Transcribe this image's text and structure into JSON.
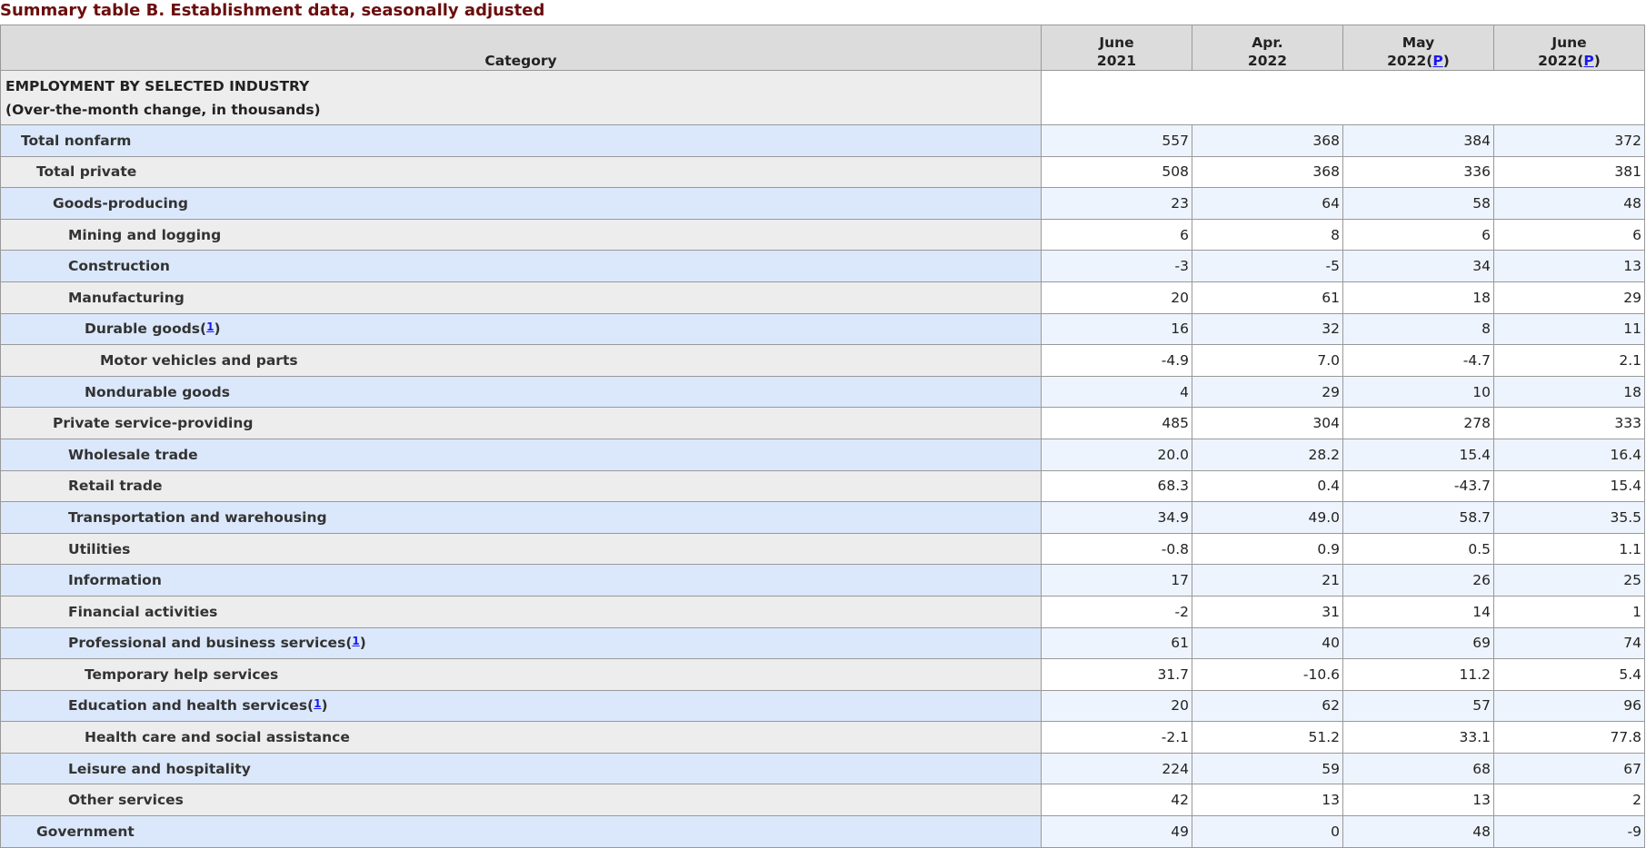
{
  "caption": "Summary table B. Establishment data, seasonally adjusted",
  "header": {
    "category": "Category",
    "columns": [
      {
        "line1": "June",
        "line2": "2021",
        "preliminary": false
      },
      {
        "line1": "Apr.",
        "line2": "2022",
        "preliminary": false
      },
      {
        "line1": "May",
        "line2": "2022",
        "preliminary": true
      },
      {
        "line1": "June",
        "line2": "2022",
        "preliminary": true
      }
    ],
    "p_marker": "P"
  },
  "section": {
    "line1": "EMPLOYMENT BY SELECTED INDUSTRY",
    "line2": "(Over-the-month change, in thousands)"
  },
  "rows": [
    {
      "label": "Total nonfarm",
      "level": 1,
      "values": [
        "557",
        "368",
        "384",
        "372"
      ]
    },
    {
      "label": "Total private",
      "level": 2,
      "values": [
        "508",
        "368",
        "336",
        "381"
      ]
    },
    {
      "label": "Goods-producing",
      "level": 3,
      "values": [
        "23",
        "64",
        "58",
        "48"
      ]
    },
    {
      "label": "Mining and logging",
      "level": 4,
      "values": [
        "6",
        "8",
        "6",
        "6"
      ]
    },
    {
      "label": "Construction",
      "level": 4,
      "values": [
        "-3",
        "-5",
        "34",
        "13"
      ]
    },
    {
      "label": "Manufacturing",
      "level": 4,
      "values": [
        "20",
        "61",
        "18",
        "29"
      ]
    },
    {
      "label": "Durable goods",
      "level": 5,
      "footnote": "1",
      "values": [
        "16",
        "32",
        "8",
        "11"
      ]
    },
    {
      "label": "Motor vehicles and parts",
      "level": 6,
      "values": [
        "-4.9",
        "7.0",
        "-4.7",
        "2.1"
      ]
    },
    {
      "label": "Nondurable goods",
      "level": 5,
      "values": [
        "4",
        "29",
        "10",
        "18"
      ]
    },
    {
      "label": "Private service-providing",
      "level": 3,
      "values": [
        "485",
        "304",
        "278",
        "333"
      ]
    },
    {
      "label": "Wholesale trade",
      "level": 4,
      "values": [
        "20.0",
        "28.2",
        "15.4",
        "16.4"
      ]
    },
    {
      "label": "Retail trade",
      "level": 4,
      "values": [
        "68.3",
        "0.4",
        "-43.7",
        "15.4"
      ]
    },
    {
      "label": "Transportation and warehousing",
      "level": 4,
      "values": [
        "34.9",
        "49.0",
        "58.7",
        "35.5"
      ]
    },
    {
      "label": "Utilities",
      "level": 4,
      "values": [
        "-0.8",
        "0.9",
        "0.5",
        "1.1"
      ]
    },
    {
      "label": "Information",
      "level": 4,
      "values": [
        "17",
        "21",
        "26",
        "25"
      ]
    },
    {
      "label": "Financial activities",
      "level": 4,
      "values": [
        "-2",
        "31",
        "14",
        "1"
      ]
    },
    {
      "label": "Professional and business services",
      "level": 4,
      "footnote": "1",
      "values": [
        "61",
        "40",
        "69",
        "74"
      ]
    },
    {
      "label": "Temporary help services",
      "level": 5,
      "values": [
        "31.7",
        "-10.6",
        "11.2",
        "5.4"
      ]
    },
    {
      "label": "Education and health services",
      "level": 4,
      "footnote": "1",
      "values": [
        "20",
        "62",
        "57",
        "96"
      ]
    },
    {
      "label": "Health care and social assistance",
      "level": 5,
      "values": [
        "-2.1",
        "51.2",
        "33.1",
        "77.8"
      ]
    },
    {
      "label": "Leisure and hospitality",
      "level": 4,
      "values": [
        "224",
        "59",
        "68",
        "67"
      ]
    },
    {
      "label": "Other services",
      "level": 4,
      "values": [
        "42",
        "13",
        "13",
        "2"
      ]
    },
    {
      "label": "Government",
      "level": 2,
      "values": [
        "49",
        "0",
        "48",
        "-9"
      ]
    }
  ]
}
